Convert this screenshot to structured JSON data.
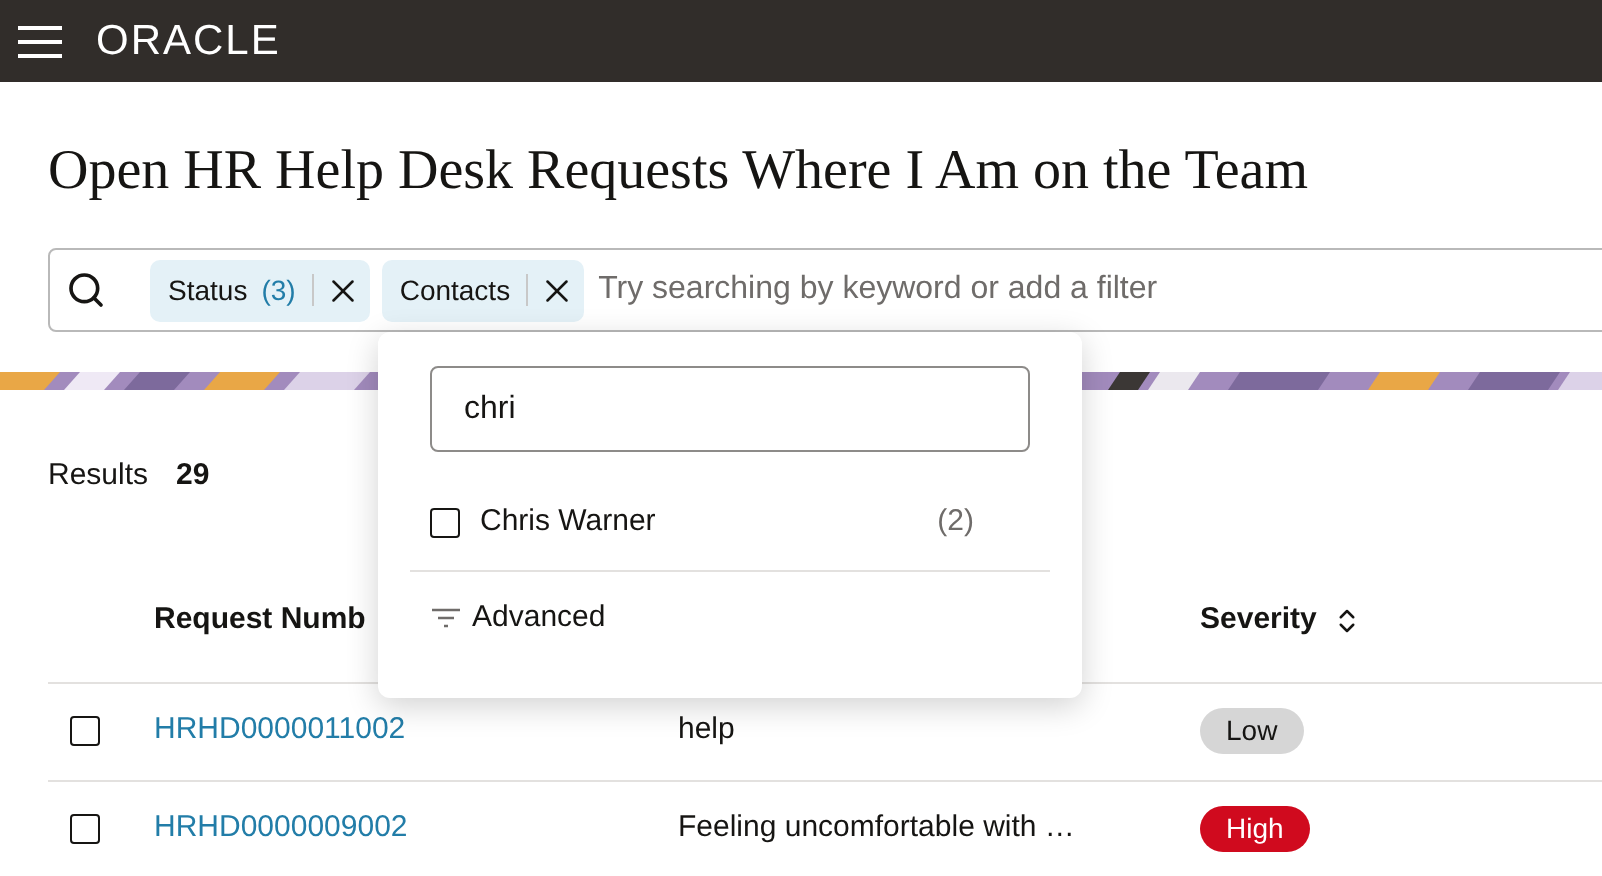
{
  "header": {
    "logo": "ORACLE"
  },
  "title": "Open HR Help Desk Requests Where I Am on the Team",
  "search": {
    "placeholder": "Try searching by keyword or add a filter",
    "filters": [
      {
        "label": "Status",
        "count": "(3)"
      },
      {
        "label": "Contacts"
      }
    ]
  },
  "results": {
    "label": "Results",
    "count": "29"
  },
  "table": {
    "columns": [
      {
        "label": "Request Numb",
        "sortable": false
      },
      {
        "label": "Severity",
        "sortable": true
      }
    ],
    "rows": [
      {
        "checked": false,
        "id": "HRHD0000011002",
        "summary": "help",
        "severity": "Low",
        "kind": "low"
      },
      {
        "checked": false,
        "id": "HRHD0000009002",
        "summary": "Feeling uncomfortable with …",
        "severity": "High",
        "kind": "high"
      }
    ]
  },
  "popup": {
    "value": "chri",
    "options": [
      {
        "label": "Chris Warner",
        "count": "(2)",
        "checked": false
      }
    ],
    "advanced": "Advanced"
  }
}
